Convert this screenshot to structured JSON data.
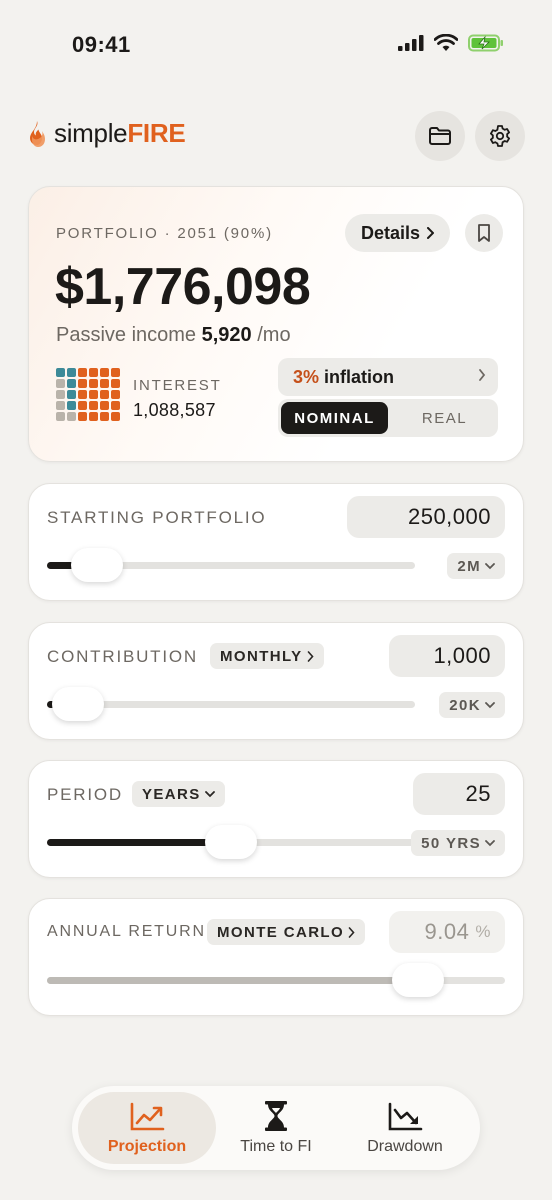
{
  "status": {
    "time": "09:41"
  },
  "brand": {
    "simple": "simple",
    "fire": "FIRE"
  },
  "colors": {
    "accent": "#e0611e",
    "dark": "#1c1a18",
    "teal": "#3d8a98",
    "orange": "#e0611e",
    "grey": "#b9b3aa"
  },
  "summary": {
    "label": "PORTFOLIO · 2051 (90%)",
    "details_label": "Details",
    "value": "$1,776,098",
    "passive_prefix": "Passive income",
    "passive_amount": "5,920",
    "passive_suffix": "/mo",
    "interest_label": "INTEREST",
    "interest_value": "1,088,587",
    "inflation_pct": "3%",
    "inflation_label": "inflation",
    "seg_nominal": "NOMINAL",
    "seg_real": "REAL",
    "selected_mode": "NOMINAL"
  },
  "controls": {
    "starting": {
      "label": "STARTING PORTFOLIO",
      "value": "250,000",
      "range": "2M",
      "level": 0.135
    },
    "contribution": {
      "label": "CONTRIBUTION",
      "chip": "MONTHLY",
      "value": "1,000",
      "range": "20K",
      "level": 0.085
    },
    "period": {
      "label": "PERIOD",
      "chip": "YEARS",
      "value": "25",
      "range": "50 YRS",
      "level": 0.5
    },
    "return": {
      "label": "ANNUAL RETURN",
      "chip": "MONTE CARLO",
      "value": "9.04",
      "unit": "%",
      "level": 0.81
    }
  },
  "tabs": [
    {
      "label": "Projection",
      "icon": "chart-up-icon",
      "active": true
    },
    {
      "label": "Time to FI",
      "icon": "hourglass-icon",
      "active": false
    },
    {
      "label": "Drawdown",
      "icon": "chart-down-icon",
      "active": false
    }
  ]
}
